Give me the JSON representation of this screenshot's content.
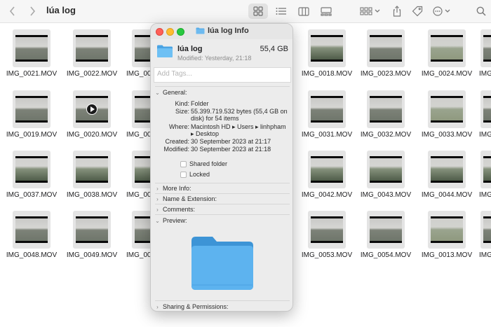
{
  "window": {
    "title": "lúa log"
  },
  "toolbar": {
    "back_icon": "chevron-left-icon",
    "forward_icon": "chevron-right-icon",
    "view_icons": [
      "grid-view-icon",
      "list-view-icon",
      "column-view-icon",
      "gallery-view-icon"
    ],
    "group_icon": "group-icon",
    "share_icon": "share-icon",
    "tag_icon": "tag-icon",
    "more_icon": "ellipsis-icon",
    "search_icon": "search-icon"
  },
  "files": [
    {
      "name": "IMG_0021.MOV"
    },
    {
      "name": "IMG_0022.MOV"
    },
    {
      "name": "IMG_00"
    },
    {
      "name": "IMG_0018.MOV"
    },
    {
      "name": "IMG_0023.MOV"
    },
    {
      "name": "IMG_0024.MOV"
    },
    {
      "name": "IMG"
    },
    {
      "name": "IMG_0019.MOV"
    },
    {
      "name": "IMG_0020.MOV"
    },
    {
      "name": "IMG_00"
    },
    {
      "name": "IMG_0031.MOV"
    },
    {
      "name": "IMG_0032.MOV"
    },
    {
      "name": "IMG_0033.MOV"
    },
    {
      "name": "IMG"
    },
    {
      "name": "IMG_0037.MOV"
    },
    {
      "name": "IMG_0038.MOV"
    },
    {
      "name": "IMG_00"
    },
    {
      "name": "IMG_0042.MOV"
    },
    {
      "name": "IMG_0043.MOV"
    },
    {
      "name": "IMG_0044.MOV"
    },
    {
      "name": "IMG"
    },
    {
      "name": "IMG_0048.MOV"
    },
    {
      "name": "IMG_0049.MOV"
    },
    {
      "name": "IMG_00"
    },
    {
      "name": "IMG_0053.MOV"
    },
    {
      "name": "IMG_0054.MOV"
    },
    {
      "name": "IMG_0013.MOV"
    },
    {
      "name": "IMG"
    }
  ],
  "info": {
    "title": "lúa log Info",
    "name": "lúa log",
    "size": "55,4 GB",
    "modified": "Modified: Yesterday, 21:18",
    "tags_placeholder": "Add Tags...",
    "general": {
      "label": "General:",
      "kind_key": "Kind:",
      "kind": "Folder",
      "size_key": "Size:",
      "size": "55.399.719.532 bytes (55,4 GB on disk) for 54 items",
      "where_key": "Where:",
      "where": "Macintosh HD ▸ Users ▸ linhpham ▸ Desktop",
      "created_key": "Created:",
      "created": "30 September 2023 at 21:17",
      "modified_key": "Modified:",
      "modified": "30 September 2023 at 21:18",
      "shared": "Shared folder",
      "locked": "Locked"
    },
    "more_info": "More Info:",
    "name_ext": "Name & Extension:",
    "comments": "Comments:",
    "preview": "Preview:",
    "sharing": "Sharing & Permissions:"
  },
  "colors": {
    "folder": "#5aaee8",
    "folder_dark": "#3d94d6",
    "close": "#fe5f57",
    "minimize": "#febc2e",
    "maximize": "#28c840"
  }
}
